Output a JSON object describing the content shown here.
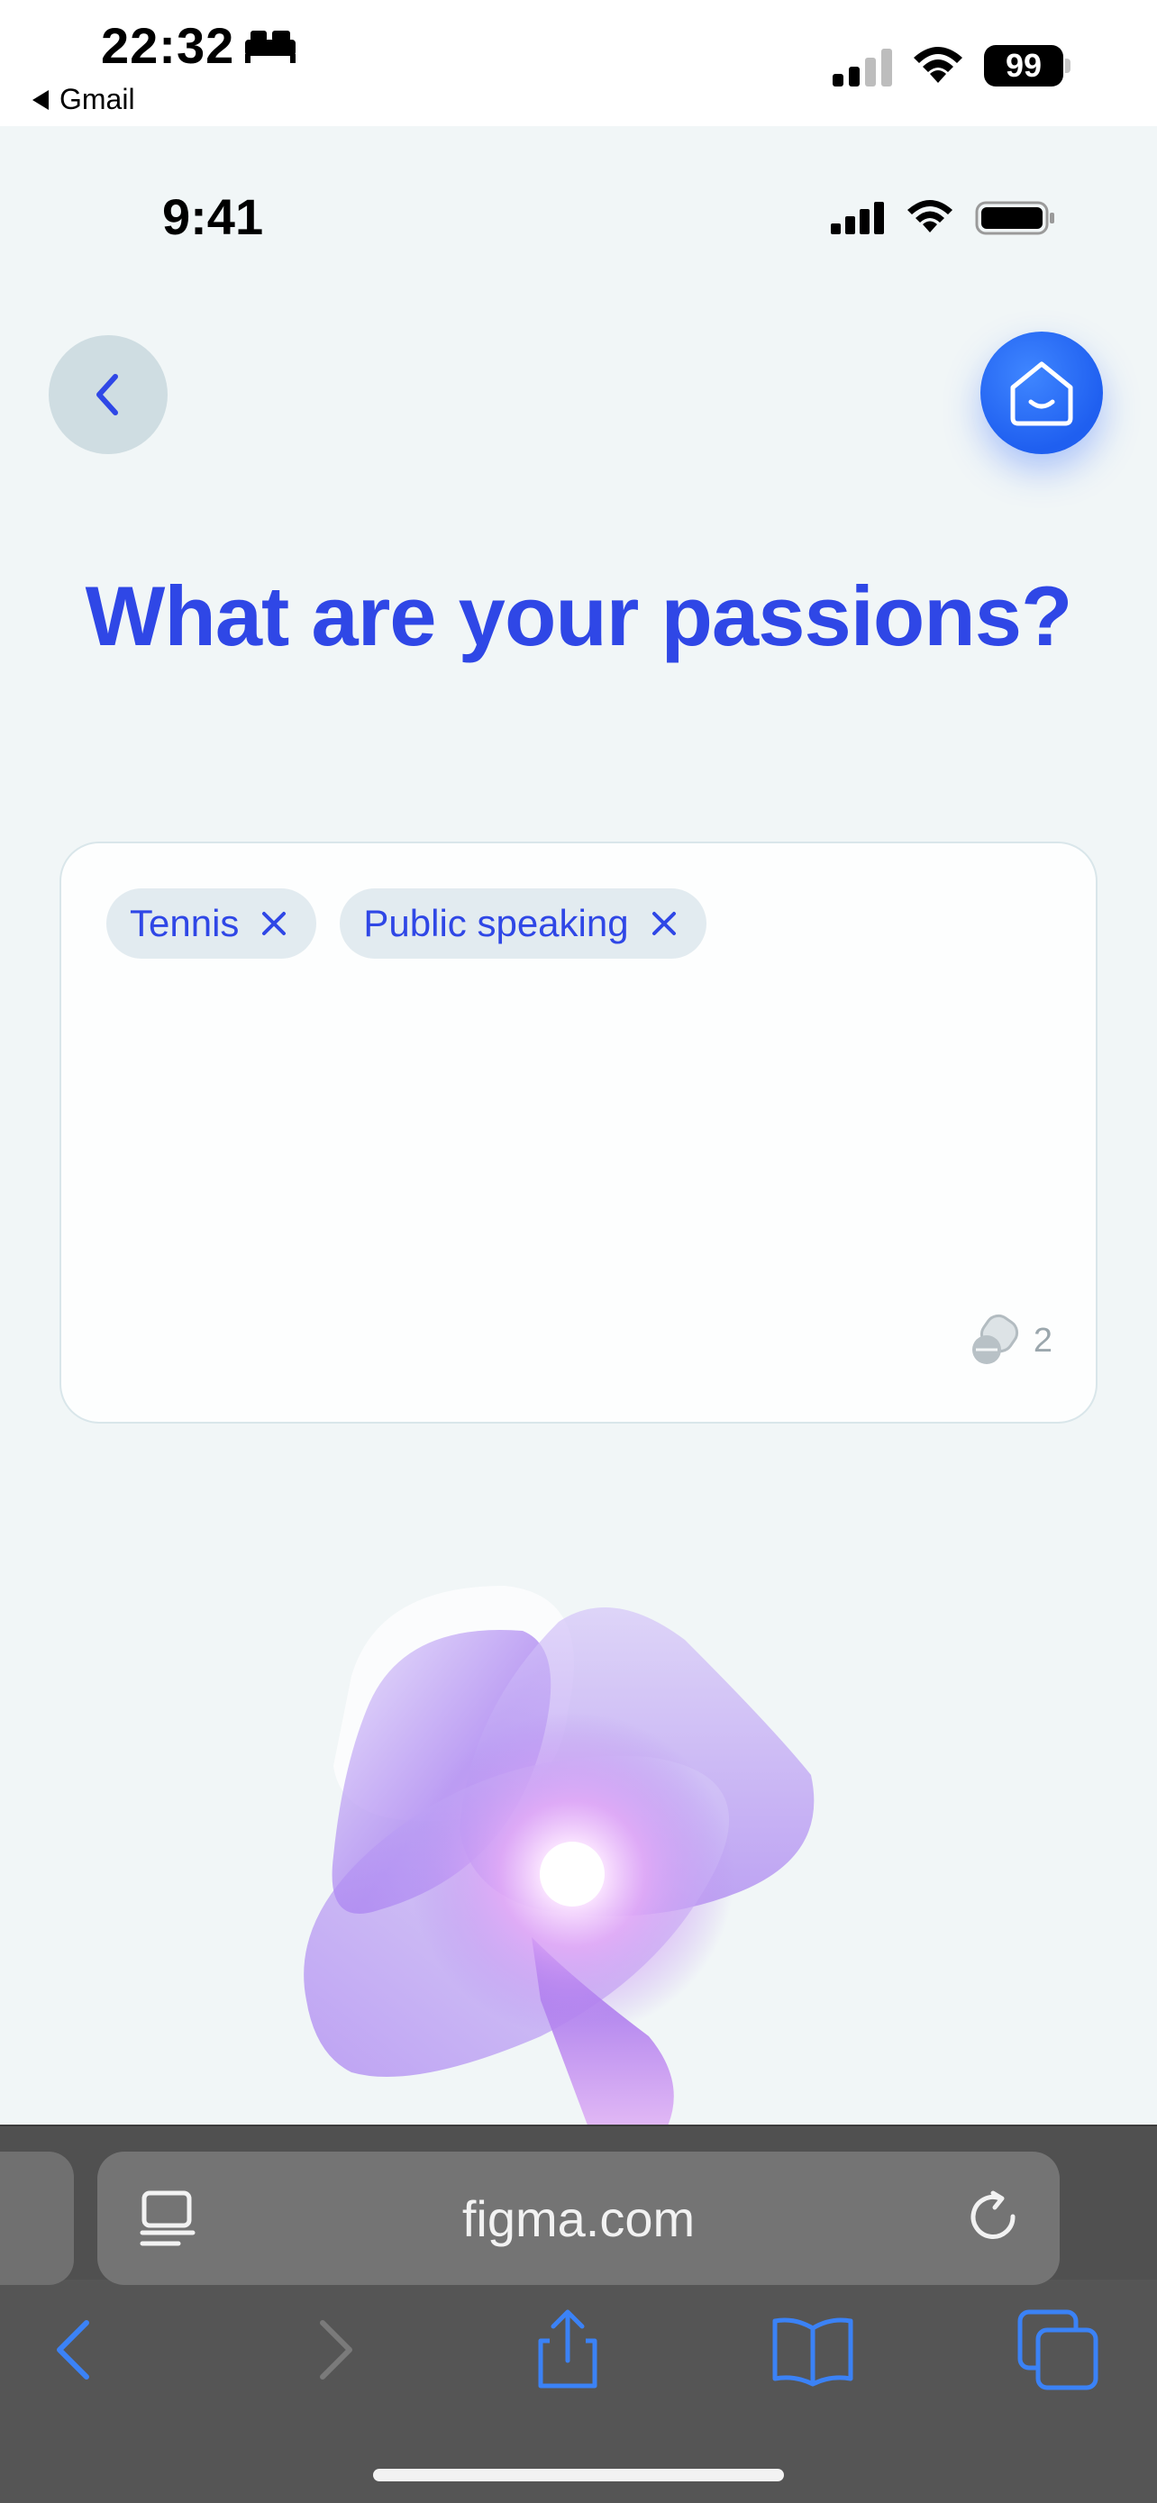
{
  "os_status": {
    "time": "22:32",
    "back_app": "Gmail",
    "battery": "99"
  },
  "app": {
    "status_time": "9:41",
    "title": "What are your passions?",
    "tags": [
      {
        "label": "Tennis"
      },
      {
        "label": "Public speaking"
      }
    ],
    "tag_count": "2"
  },
  "browser": {
    "url": "figma.com"
  },
  "colors": {
    "accent": "#2f47e6",
    "home_button": "#1f5ff0",
    "chip_bg": "#e2ebf0",
    "page_bg": "#f1f6f7",
    "safari_bar": "#555555",
    "safari_icon": "#3b82f6"
  }
}
